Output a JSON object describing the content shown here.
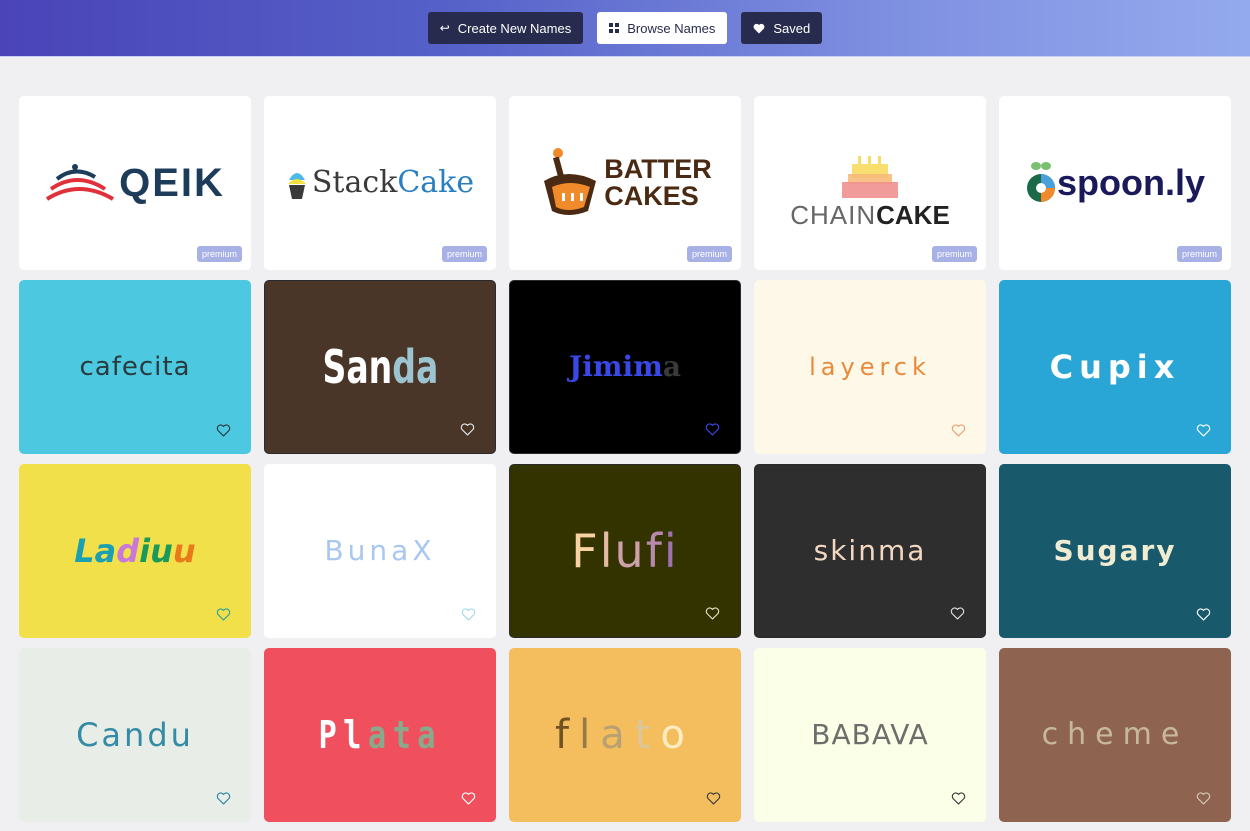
{
  "nav": {
    "create_label": "Create New Names",
    "browse_label": "Browse Names",
    "saved_label": "Saved",
    "icons": {
      "create": "arrow-left-icon",
      "browse": "grid-icon",
      "saved": "heart-icon"
    }
  },
  "premium_badge": "premium",
  "premium_logos": [
    {
      "name": "QEIK",
      "colors": [
        "#1d3c5a",
        "#e0303a"
      ]
    },
    {
      "name_part1": "Stack",
      "name_part2": "Cake",
      "colors": [
        "#3a3a3a",
        "#2a7fc0"
      ]
    },
    {
      "line1": "BATTER",
      "line2": "CAKES",
      "colors": [
        "#4a2a12",
        "#f08a2a"
      ]
    },
    {
      "name_part1": "CHAIN",
      "name_part2": "CAKE",
      "colors": [
        "#666666",
        "#222222"
      ]
    },
    {
      "name": "spoon.ly",
      "colors": [
        "#1a1a5a",
        "#f08a2a"
      ]
    }
  ],
  "names": [
    {
      "name": "cafecita",
      "bg": "#4cc8e0",
      "fg": "#2b3a3e",
      "heart": "#2b3a3e"
    },
    {
      "name": "Sanda",
      "bg": "#4a3628",
      "fg": "#ffffff",
      "fg2": "#9cc3d0",
      "heart": "#e8e8e8"
    },
    {
      "name": "Jimima",
      "bg": "#000000",
      "fg": "#3a48e8",
      "fg2": "#3a3a3a",
      "heart": "#3a48e8"
    },
    {
      "name": "layerck",
      "bg": "#fdf8e8",
      "fg": "#e88a3a",
      "heart": "#e8a070"
    },
    {
      "name": "Cupix",
      "bg": "#2aa6d6",
      "fg": "#ffffff",
      "heart": "#ffffff"
    },
    {
      "name": "Ladiuu",
      "bg": "#f2e04a",
      "fg": "#1aa0b0",
      "heart": "#2aa0a0"
    },
    {
      "name": "BunaX",
      "bg": "#ffffff",
      "fg": "#a8c8f0",
      "heart": "#a8d8f0"
    },
    {
      "name": "Flufi",
      "bg": "#333300",
      "fg": "#f8d2a2",
      "fg2": "#a070b0",
      "heart": "#e8e0c8"
    },
    {
      "name": "skinma",
      "bg": "#2e2e2e",
      "fg": "#f2d8c0",
      "heart": "#e0e0e0"
    },
    {
      "name": "Sugary",
      "bg": "#185a6c",
      "fg": "#f0ecd2",
      "heart": "#ffffff"
    },
    {
      "name": "Candu",
      "bg": "#e8ede8",
      "fg": "#2a86a2",
      "heart": "#2a86a2"
    },
    {
      "name": "Plata",
      "bg": "#f0505e",
      "fg": "#ffffff",
      "fg2": "#8aa88a",
      "heart": "#ffffff"
    },
    {
      "name": "flato",
      "bg": "#f4be5e",
      "fg": "#6a4e20",
      "fg2": "#fff0c8",
      "heart": "#3a3a3a"
    },
    {
      "name": "BABAVA",
      "bg": "#fcffe8",
      "fg": "#666666",
      "heart": "#3a3a3a"
    },
    {
      "name": "cheme",
      "bg": "#8e6450",
      "fg": "#c8b89a",
      "heart": "#d8c8b8"
    }
  ]
}
